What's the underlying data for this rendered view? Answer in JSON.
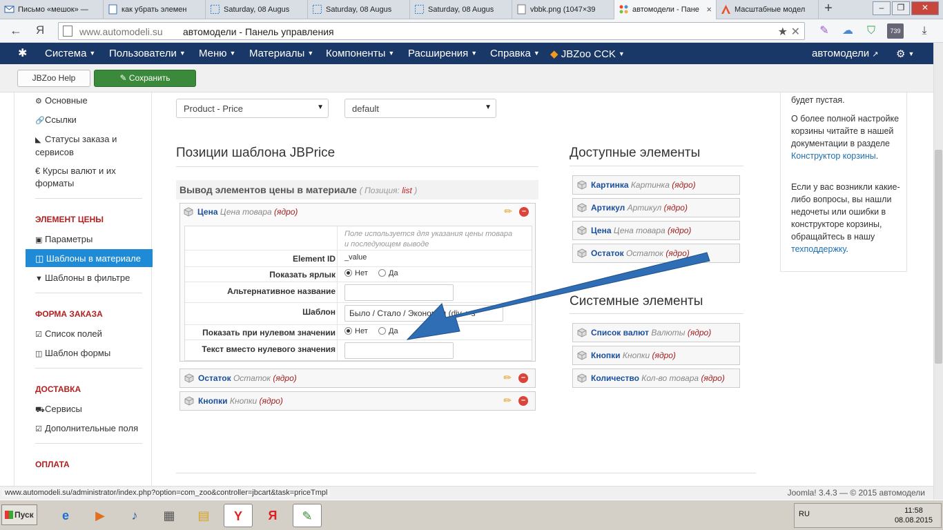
{
  "browser": {
    "tabs": [
      {
        "label": "Письмо «мешок» —",
        "icon": "mail-icon"
      },
      {
        "label": "как убрать элемен",
        "icon": "page-icon"
      },
      {
        "label": "Saturday, 08 Augus",
        "icon": "screenshot-icon"
      },
      {
        "label": "Saturday, 08 Augus",
        "icon": "screenshot-icon"
      },
      {
        "label": "Saturday, 08 Augus",
        "icon": "screenshot-icon"
      },
      {
        "label": "vbbk.png (1047×39",
        "icon": "page-icon"
      },
      {
        "label": "автомодели - Пане",
        "icon": "joomla-icon"
      },
      {
        "label": "Масштабные модел",
        "icon": "a-icon"
      }
    ],
    "back_symbol": "←",
    "ya_symbol": "Я",
    "url_host": "www.automodeli.su",
    "url_title": "автомодели - Панель управления",
    "badge_count": "739"
  },
  "joomla_nav": {
    "items": [
      "Система",
      "Пользователи",
      "Меню",
      "Материалы",
      "Компоненты",
      "Расширения",
      "Справка",
      "JBZoo CCK"
    ],
    "site_link": "автомодели"
  },
  "toolbar": {
    "help_label": "JBZoo Help",
    "save_label": "Сохранить"
  },
  "sidebar": {
    "items_top": [
      "Основные",
      "Ссылки",
      "Статусы заказа и сервисов",
      "€ Курсы валют и их форматы"
    ],
    "section_price": "ЭЛЕМЕНТ ЦЕНЫ",
    "price_items": [
      "Параметры",
      "Шаблоны в материале",
      "Шаблоны в фильтре"
    ],
    "section_order": "ФОРМА ЗАКАЗА",
    "order_items": [
      "Список полей",
      "Шаблон формы"
    ],
    "section_delivery": "ДОСТАВКА",
    "delivery_items": [
      "Сервисы",
      "Дополнительные поля"
    ],
    "section_payment": "ОПЛАТА"
  },
  "selects": {
    "element": "Product - Price",
    "template": "default"
  },
  "positions": {
    "title": "Позиции шаблона JBPrice",
    "group_title": "Вывод элементов цены в материале",
    "group_position_label": "( Позиция:",
    "group_position_value": "list",
    "group_position_end": ")",
    "elements": [
      {
        "name": "Цена",
        "type": "Цена товара",
        "core": "(ядро)"
      },
      {
        "name": "Остаток",
        "type": "Остаток",
        "core": "(ядро)"
      },
      {
        "name": "Кнопки",
        "type": "Кнопки",
        "core": "(ядро)"
      }
    ],
    "config": {
      "hint": "Поле используется для указания цены товара и последующем выводе",
      "element_id_label": "Element ID",
      "element_id_value": "_value",
      "show_label_label": "Показать ярлык",
      "no": "Нет",
      "yes": "Да",
      "alt_name_label": "Альтернативное название",
      "template_label": "Шаблон",
      "template_value": "Было / Стало / Экономия (div + s",
      "show_zero_label": "Показать при нулевом значении",
      "zero_text_label": "Текст вместо нулевого значения"
    }
  },
  "available": {
    "title": "Доступные элементы",
    "elements": [
      {
        "name": "Картинка",
        "type": "Картинка",
        "core": "(ядро)"
      },
      {
        "name": "Артикул",
        "type": "Артикул",
        "core": "(ядро)"
      },
      {
        "name": "Цена",
        "type": "Цена товара",
        "core": "(ядро)"
      },
      {
        "name": "Остаток",
        "type": "Остаток",
        "core": "(ядро)"
      }
    ]
  },
  "system": {
    "title": "Системные элементы",
    "elements": [
      {
        "name": "Список валют",
        "type": "Валюты",
        "core": "(ядро)"
      },
      {
        "name": "Кнопки",
        "type": "Кнопки",
        "core": "(ядро)"
      },
      {
        "name": "Количество",
        "type": "Кол-во товара",
        "core": "(ядро)"
      }
    ]
  },
  "help_box": {
    "p1": "будет пустая.",
    "p2": "О более полной настройке корзины читайте в нашей документации в разделе",
    "p2_link": "Конструктор корзины",
    "p2_end": ".",
    "p3": "Если у вас возникли какие-либо вопросы, вы нашли недочеты или ошибки в конструкторе корзины, обращайтесь в нашу",
    "p3_link": "техподдержку",
    "p3_end": "."
  },
  "status": {
    "url": "www.automodeli.su/administrator/index.php?option=com_zoo&controller=jbcart&task=priceTmpl",
    "footer": "Joomla! 3.4.3 — © 2015 автомодели"
  },
  "taskbar": {
    "start": "Пуск",
    "lang": "RU",
    "time": "11:58",
    "date": "08.08.2015"
  },
  "colors": {
    "navbar": "#1a3867",
    "save_button": "#3b8a3b",
    "active_sidebar": "#1f8bd6",
    "section_heading": "#b21f1f",
    "element_name": "#1a4f9c",
    "annotation_arrow": "#2f6db5"
  }
}
